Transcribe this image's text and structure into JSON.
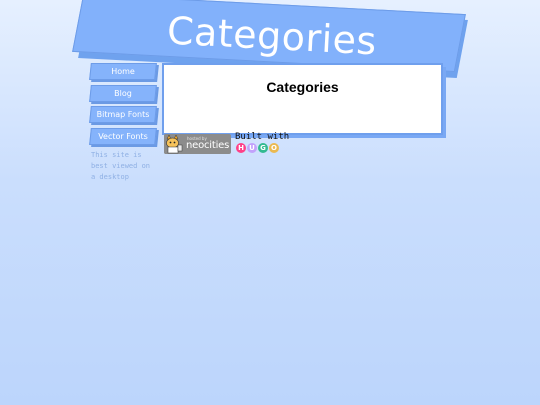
{
  "header": {
    "title": "Categories"
  },
  "nav": {
    "items": [
      {
        "label": "Home"
      },
      {
        "label": "Blog"
      },
      {
        "label": "Bitmap Fonts"
      },
      {
        "label": "Vector Fonts"
      }
    ],
    "note": "This site is best viewed on a desktop"
  },
  "main": {
    "heading": "Categories"
  },
  "footer": {
    "neocities_badge": {
      "small_text": "hosted by",
      "big_text": "neocities",
      "icon": "neocities-cat-icon"
    },
    "hugo_badge": {
      "built_with": "Built with",
      "letters": [
        "H",
        "U",
        "G",
        "O"
      ]
    }
  },
  "colors": {
    "banner": "#82b1fb",
    "panel_border": "#6f9fed",
    "hugo_h": "#ff4088",
    "hugo_u": "#c2a2fb",
    "hugo_g": "#33ba91",
    "hugo_o": "#ebb951"
  }
}
